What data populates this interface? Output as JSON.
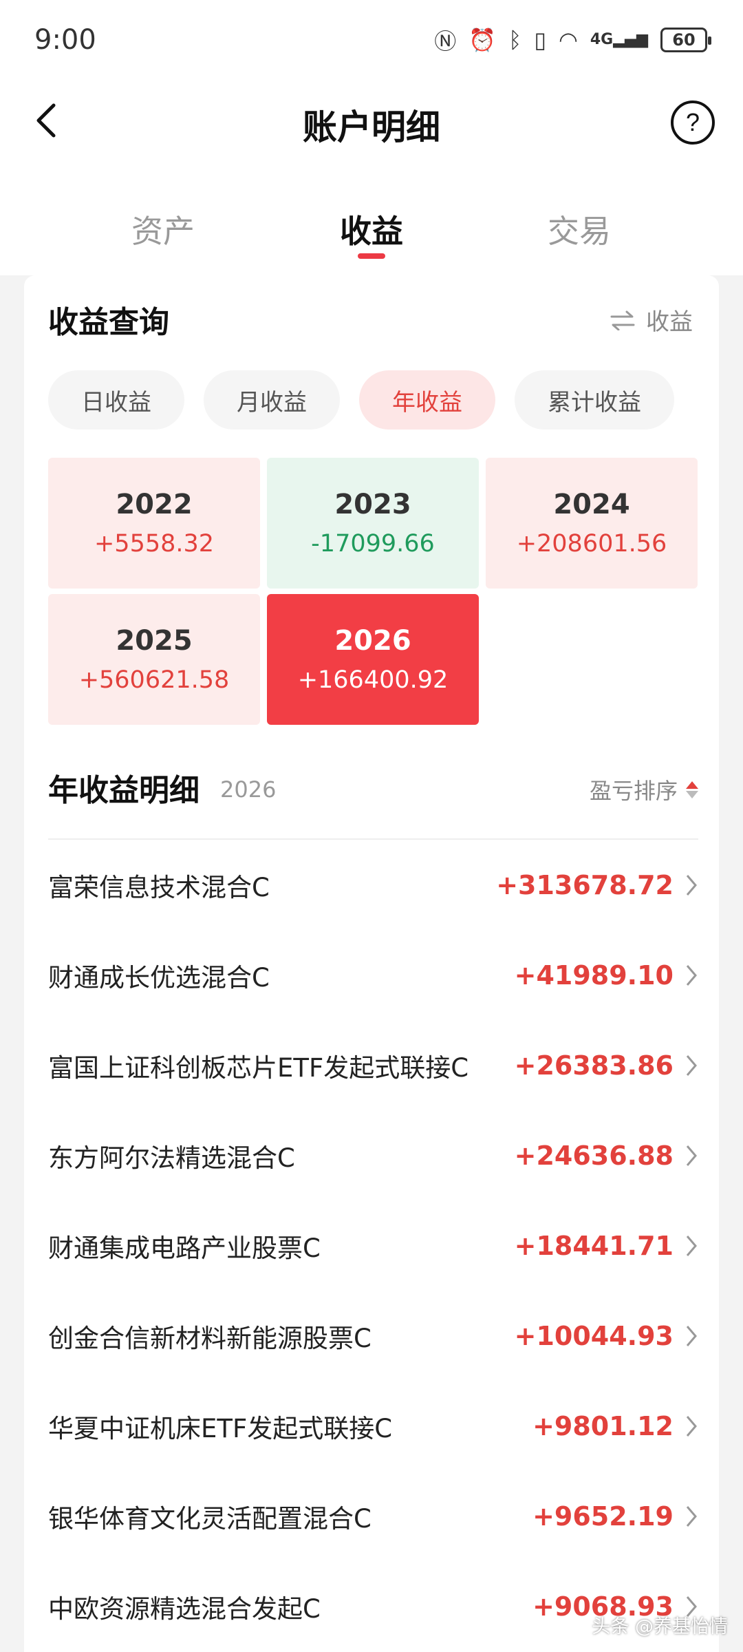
{
  "status_bar": {
    "time": "9:00",
    "network": "4G",
    "battery": "60"
  },
  "header": {
    "title": "账户明细"
  },
  "tabs": [
    {
      "label": "资产",
      "active": false
    },
    {
      "label": "收益",
      "active": true
    },
    {
      "label": "交易",
      "active": false
    }
  ],
  "query": {
    "title": "收益查询",
    "toggle_label": "收益",
    "chips": [
      {
        "label": "日收益",
        "active": false
      },
      {
        "label": "月收益",
        "active": false
      },
      {
        "label": "年收益",
        "active": true
      },
      {
        "label": "累计收益",
        "active": false
      }
    ]
  },
  "years": [
    {
      "year": "2022",
      "value": "+5558.32",
      "status": "pos"
    },
    {
      "year": "2023",
      "value": "-17099.66",
      "status": "neg"
    },
    {
      "year": "2024",
      "value": "+208601.56",
      "status": "pos"
    },
    {
      "year": "2025",
      "value": "+560621.58",
      "status": "pos"
    },
    {
      "year": "2026",
      "value": "+166400.92",
      "status": "active"
    }
  ],
  "detail": {
    "title": "年收益明细",
    "year": "2026",
    "sort_label": "盈亏排序"
  },
  "funds": [
    {
      "name": "富荣信息技术混合C",
      "value": "+313678.72"
    },
    {
      "name": "财通成长优选混合C",
      "value": "+41989.10"
    },
    {
      "name": "富国上证科创板芯片ETF发起式联接C",
      "value": "+26383.86"
    },
    {
      "name": "东方阿尔法精选混合C",
      "value": "+24636.88"
    },
    {
      "name": "财通集成电路产业股票C",
      "value": "+18441.71"
    },
    {
      "name": "创金合信新材料新能源股票C",
      "value": "+10044.93"
    },
    {
      "name": "华夏中证机床ETF发起式联接C",
      "value": "+9801.12"
    },
    {
      "name": "银华体育文化灵活配置混合C",
      "value": "+9652.19"
    },
    {
      "name": "中欧资源精选混合发起C",
      "value": "+9068.93"
    }
  ],
  "watermark": "头条 @养基怡情",
  "colors": {
    "accent_red": "#f23e45",
    "gain_red": "#e2413c",
    "loss_green": "#1f9b5c"
  }
}
